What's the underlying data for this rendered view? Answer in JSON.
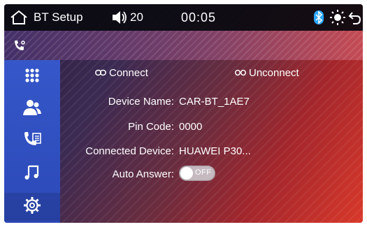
{
  "topbar": {
    "title": "BT Setup",
    "volume": "20",
    "time": "00:05",
    "icons": [
      "home-icon",
      "volume-icon",
      "bluetooth-icon",
      "brightness-icon",
      "back-icon"
    ]
  },
  "sidebar": {
    "items": [
      {
        "name": "dialpad",
        "icon": "dialpad-icon"
      },
      {
        "name": "contacts",
        "icon": "contacts-icon"
      },
      {
        "name": "call-log",
        "icon": "call-log-icon"
      },
      {
        "name": "music",
        "icon": "music-icon"
      },
      {
        "name": "settings",
        "icon": "gear-icon",
        "active": true
      }
    ]
  },
  "actions": {
    "connect": "Connect",
    "unconnect": "Unconnect"
  },
  "fields": {
    "device_name": {
      "label": "Device Name:",
      "value": "CAR-BT_1AE7"
    },
    "pin_code": {
      "label": "Pin Code:",
      "value": "0000"
    },
    "connected_device": {
      "label": "Connected Device:",
      "value": "HUAWEI P30..."
    },
    "auto_answer": {
      "label": "Auto Answer:",
      "state": "OFF"
    }
  },
  "colors": {
    "sidebar": "#3050c4",
    "topbar": "#0a0a10",
    "bluetooth": "#2aa6ff"
  }
}
